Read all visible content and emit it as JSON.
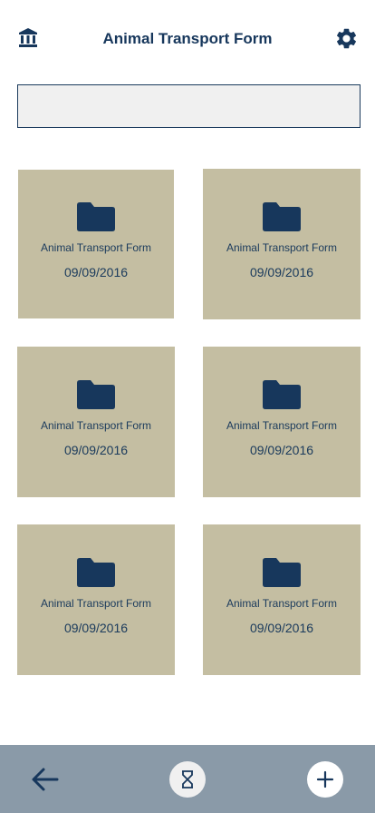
{
  "header": {
    "title": "Animal Transport Form",
    "left_icon": "institution-icon",
    "right_icon": "gear-icon"
  },
  "search": {
    "value": "",
    "placeholder": ""
  },
  "cards": [
    {
      "title": "Animal Transport Form",
      "date": "09/09/2016",
      "icon": "folder-icon"
    },
    {
      "title": "Animal Transport Form",
      "date": "09/09/2016",
      "icon": "folder-icon"
    },
    {
      "title": "Animal Transport Form",
      "date": "09/09/2016",
      "icon": "folder-icon"
    },
    {
      "title": "Animal Transport Form",
      "date": "09/09/2016",
      "icon": "folder-icon"
    },
    {
      "title": "Animal Transport Form",
      "date": "09/09/2016",
      "icon": "folder-icon"
    },
    {
      "title": "Animal Transport Form",
      "date": "09/09/2016",
      "icon": "folder-icon"
    }
  ],
  "bottom_bar": {
    "back_icon": "arrow-left-icon",
    "middle_icon": "hourglass-icon",
    "right_icon": "plus-icon"
  },
  "colors": {
    "primary": "#17375c",
    "card": "#c4bea2",
    "bottom_bar": "#8a9aa8",
    "search_bg": "#f0f0f0"
  }
}
